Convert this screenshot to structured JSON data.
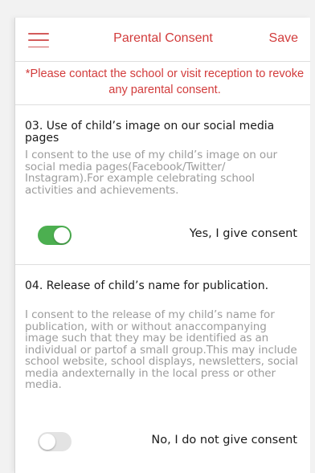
{
  "header": {
    "title": "Parental Consent",
    "save_label": "Save"
  },
  "notice": "*Please contact the school or visit reception to revoke any parental consent.",
  "consents": [
    {
      "title": "03. Use of child’s image on our social media pages",
      "description": "I consent to the use of my child’s image on our social media pages(Facebook/Twitter/ Instagram).For example celebrating school activities and achievements.",
      "toggle_on": true,
      "status_label": "Yes, I give consent"
    },
    {
      "title": "04. Release of child’s name for publication.",
      "description": "I consent to the release of my child’s name for publication, with or without anaccompanying image such that they may be identified as an individual or partof a small group.This may include school website, school displays, newsletters, social media andexternally in the local press or other media.",
      "toggle_on": false,
      "status_label": "No, I do not give consent"
    }
  ],
  "colors": {
    "accent": "#d23c3c",
    "toggle_on": "#4caf50",
    "toggle_off": "#e3e3e3"
  },
  "icons": {
    "menu": "hamburger-menu-icon"
  }
}
